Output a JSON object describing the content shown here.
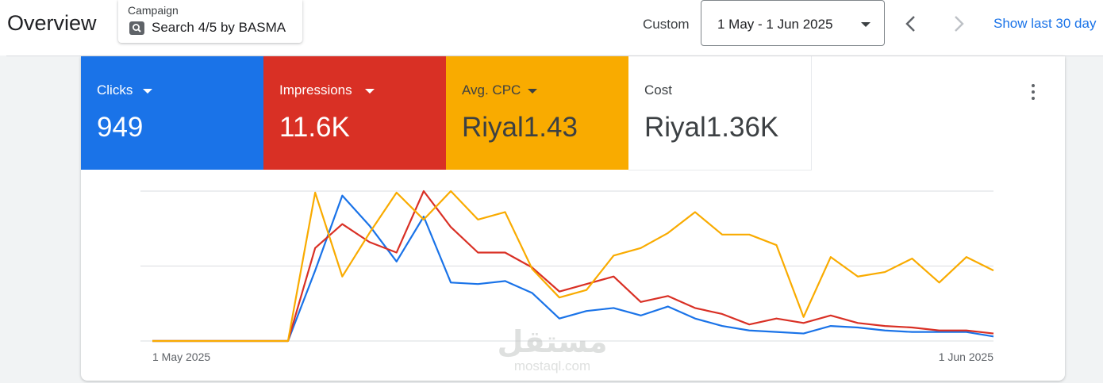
{
  "header": {
    "title": "Overview",
    "campaign_label": "Campaign",
    "campaign_value": "Search 4/5 by BASMA",
    "campaign_icon": "search-icon",
    "custom_label": "Custom",
    "date_range": "1 May - 1 Jun 2025",
    "prev_icon": "chevron-left-icon",
    "next_icon": "chevron-right-icon",
    "show_last": "Show last 30 day"
  },
  "metrics": [
    {
      "label": "Clicks",
      "value": "949",
      "color": "#1a73e8"
    },
    {
      "label": "Impressions",
      "value": "11.6K",
      "color": "#d93025"
    },
    {
      "label": "Avg. CPC",
      "value": "Riyal1.43",
      "color": "#f9ab00"
    },
    {
      "label": "Cost",
      "value": "Riyal1.36K",
      "color": "#ffffff"
    }
  ],
  "watermark": {
    "arabic": "مستقل",
    "latin": "mostaql.com"
  },
  "chart_data": {
    "type": "line",
    "x_start_label": "1 May 2025",
    "x_end_label": "1 Jun 2025",
    "x": [
      "1 May",
      "2 May",
      "3 May",
      "4 May",
      "5 May",
      "6 May",
      "7 May",
      "8 May",
      "9 May",
      "10 May",
      "11 May",
      "12 May",
      "13 May",
      "14 May",
      "15 May",
      "16 May",
      "17 May",
      "18 May",
      "19 May",
      "20 May",
      "21 May",
      "22 May",
      "23 May",
      "24 May",
      "25 May",
      "26 May",
      "27 May",
      "28 May",
      "29 May",
      "30 May",
      "31 May",
      "1 Jun"
    ],
    "ylim": [
      0,
      1
    ],
    "grid": true,
    "legend": "none",
    "series": [
      {
        "color": "#1a73e8",
        "values": [
          0.0,
          0.0,
          0.0,
          0.0,
          0.0,
          0.0,
          0.47,
          0.97,
          0.77,
          0.53,
          0.83,
          0.39,
          0.38,
          0.4,
          0.32,
          0.15,
          0.2,
          0.22,
          0.17,
          0.23,
          0.15,
          0.1,
          0.07,
          0.06,
          0.05,
          0.1,
          0.09,
          0.07,
          0.06,
          0.06,
          0.06,
          0.03
        ]
      },
      {
        "color": "#d93025",
        "values": [
          0.0,
          0.0,
          0.0,
          0.0,
          0.0,
          0.0,
          0.62,
          0.78,
          0.66,
          0.59,
          1.0,
          0.76,
          0.59,
          0.59,
          0.49,
          0.33,
          0.38,
          0.43,
          0.26,
          0.3,
          0.22,
          0.18,
          0.11,
          0.15,
          0.12,
          0.17,
          0.12,
          0.1,
          0.09,
          0.07,
          0.07,
          0.05
        ]
      },
      {
        "color": "#f9ab00",
        "values": [
          0.0,
          0.0,
          0.0,
          0.0,
          0.0,
          0.0,
          0.99,
          0.43,
          0.72,
          0.99,
          0.81,
          1.0,
          0.81,
          0.86,
          0.48,
          0.29,
          0.34,
          0.57,
          0.62,
          0.72,
          0.86,
          0.71,
          0.71,
          0.64,
          0.16,
          0.56,
          0.43,
          0.46,
          0.55,
          0.39,
          0.56,
          0.47
        ]
      }
    ]
  }
}
